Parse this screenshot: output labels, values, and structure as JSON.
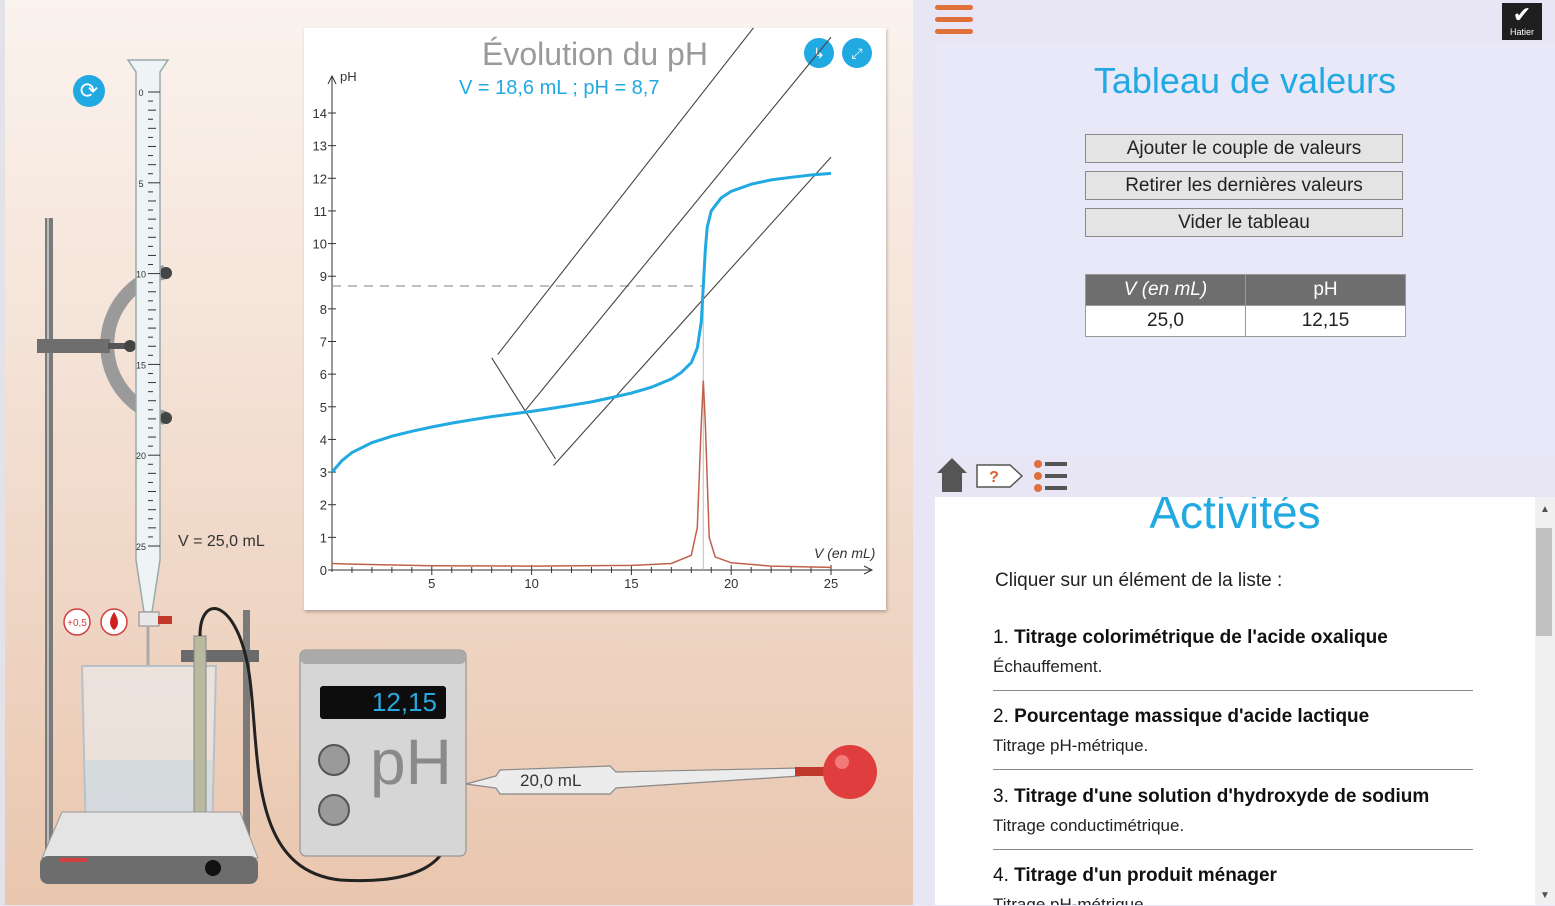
{
  "simulation": {
    "burette": {
      "ticks": [
        "0",
        "5",
        "10",
        "15",
        "20",
        "25"
      ],
      "volume_label": "V = 25,0 mL"
    },
    "drop_controls": {
      "fine_label": "+0,5"
    },
    "ph_meter": {
      "display": "12,15",
      "unit_label": "pH"
    },
    "pipette": {
      "label": "20,0 mL"
    }
  },
  "graph": {
    "title": "Évolution du pH",
    "readout": "V = 18,6 mL ; pH = 8,7",
    "y_axis_label": "pH",
    "x_axis_label": "V (en mL)"
  },
  "chart_data": {
    "type": "line",
    "title": "Évolution du pH",
    "xlabel": "V (en mL)",
    "ylabel": "pH",
    "xlim": [
      0,
      25
    ],
    "ylim": [
      0,
      14
    ],
    "x_ticks": [
      5,
      10,
      15,
      20,
      25
    ],
    "y_ticks": [
      0,
      1,
      2,
      3,
      4,
      5,
      6,
      7,
      8,
      9,
      10,
      11,
      12,
      13,
      14
    ],
    "readout": {
      "x": 18.6,
      "y": 8.7
    },
    "series": [
      {
        "color": "#21a9e1",
        "x": [
          0,
          0.5,
          1,
          2,
          3,
          4,
          5,
          6,
          7,
          8,
          9,
          10,
          11,
          12,
          13,
          14,
          15,
          16,
          17,
          17.5,
          18,
          18.3,
          18.5,
          18.6,
          18.7,
          18.8,
          19,
          19.5,
          20,
          21,
          22,
          23,
          24,
          25
        ],
        "y": [
          3.0,
          3.35,
          3.6,
          3.9,
          4.1,
          4.25,
          4.38,
          4.5,
          4.6,
          4.7,
          4.78,
          4.86,
          4.95,
          5.05,
          5.15,
          5.28,
          5.42,
          5.6,
          5.85,
          6.05,
          6.35,
          6.8,
          7.6,
          8.7,
          9.8,
          10.5,
          11.0,
          11.4,
          11.6,
          11.82,
          11.95,
          12.03,
          12.1,
          12.15
        ]
      },
      {
        "color": "#c0604a",
        "x": [
          0,
          1,
          5,
          10,
          15,
          17,
          18,
          18.3,
          18.5,
          18.6,
          18.7,
          18.9,
          19.2,
          20,
          22,
          25
        ],
        "y": [
          0.2,
          0.18,
          0.13,
          0.12,
          0.14,
          0.2,
          0.45,
          1.3,
          4.5,
          5.8,
          4.5,
          1.0,
          0.4,
          0.22,
          0.12,
          0.08
        ]
      }
    ]
  },
  "menu": {
    "icon": "hamburger-icon"
  },
  "brand": {
    "name": "Hatier"
  },
  "values_panel": {
    "title": "Tableau de valeurs",
    "add_button": "Ajouter le couple de valeurs",
    "remove_button": "Retirer les dernières valeurs",
    "clear_button": "Vider le tableau",
    "table": {
      "headers": [
        "V (en mL)",
        "pH"
      ],
      "rows": [
        [
          "25,0",
          "12,15"
        ]
      ]
    }
  },
  "nav": {
    "help_label": "?"
  },
  "activities": {
    "title": "Activités",
    "intro": "Cliquer sur un élément de la liste :",
    "items": [
      {
        "num": "1.",
        "title": "Titrage colorimétrique de l'acide oxalique",
        "subtitle": "Échauffement."
      },
      {
        "num": "2.",
        "title": "Pourcentage massique d'acide lactique",
        "subtitle": "Titrage pH-métrique."
      },
      {
        "num": "3.",
        "title": "Titrage d'une solution d'hydroxyde de sodium",
        "subtitle": "Titrage conductimétrique."
      },
      {
        "num": "4.",
        "title": "Titrage d'un produit ménager",
        "subtitle": "Titrage pH-métrique."
      }
    ]
  },
  "colors": {
    "accent": "#21a9e1",
    "orange": "#e0703a"
  }
}
